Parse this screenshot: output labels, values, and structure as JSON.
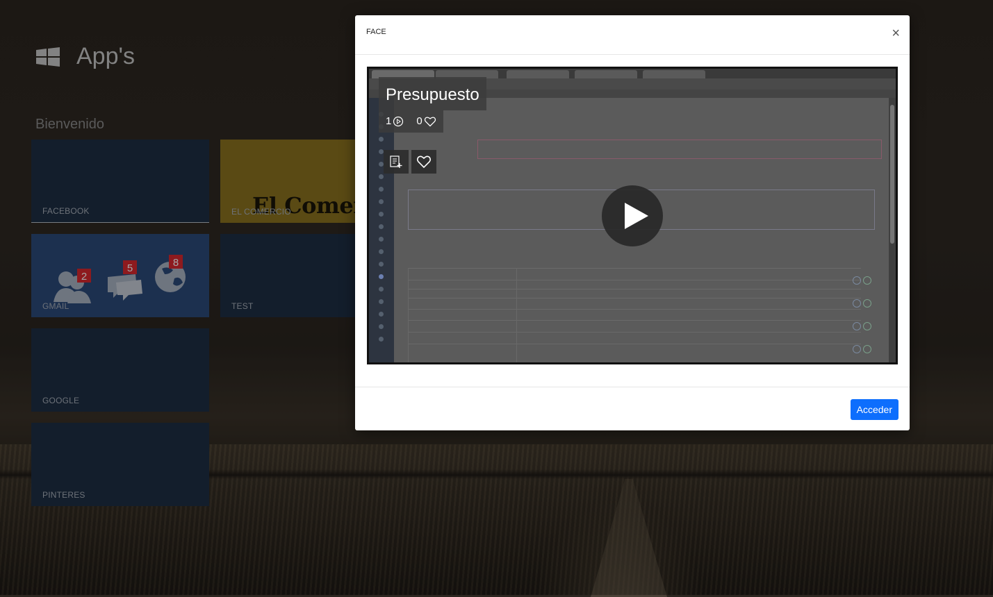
{
  "page": {
    "title": "App's",
    "welcome": "Bienvenido"
  },
  "icons": {
    "logo": "windows-logo-icon"
  },
  "tiles": [
    {
      "label": "FACEBOOK"
    },
    {
      "label": "EL COMERCIO",
      "art_text": "El Comercio"
    },
    {
      "label": "GMAIL",
      "badges": [
        "2",
        "5",
        "8"
      ]
    },
    {
      "label": "TEST"
    },
    {
      "label": "GOOGLE"
    },
    {
      "label": "PINTERES"
    }
  ],
  "modal": {
    "title": "FACE",
    "close": "×",
    "action_label": "Acceder",
    "video": {
      "title": "Presupuesto",
      "views": "1",
      "likes": "0"
    }
  },
  "colors": {
    "accent": "#0d6efd",
    "tile_dark": "#1e2e44",
    "tile_yellow": "#8b7220",
    "tile_blue": "#2c4a7a",
    "badge": "#d9282f"
  }
}
